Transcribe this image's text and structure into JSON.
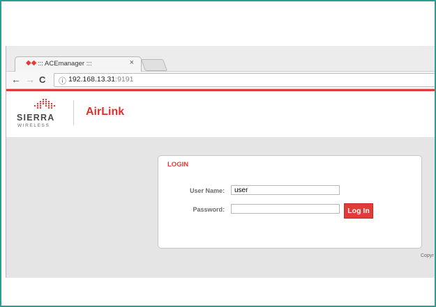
{
  "browser": {
    "tab_title": "::: ACEmanager :::",
    "tab_close": "×",
    "address": {
      "host": "192.168.13.31",
      "port": ":9191"
    }
  },
  "brand": {
    "company_name": "SIERRA",
    "company_sub": "WIRELESS",
    "product": "AirLink",
    "accent_color": "#e23a36"
  },
  "login": {
    "title": "LOGIN",
    "username_label": "User Name:",
    "username_value": "user",
    "password_label": "Password:",
    "password_value": "",
    "submit_label": "Log In"
  },
  "footer": {
    "copyright": "Copyr"
  }
}
